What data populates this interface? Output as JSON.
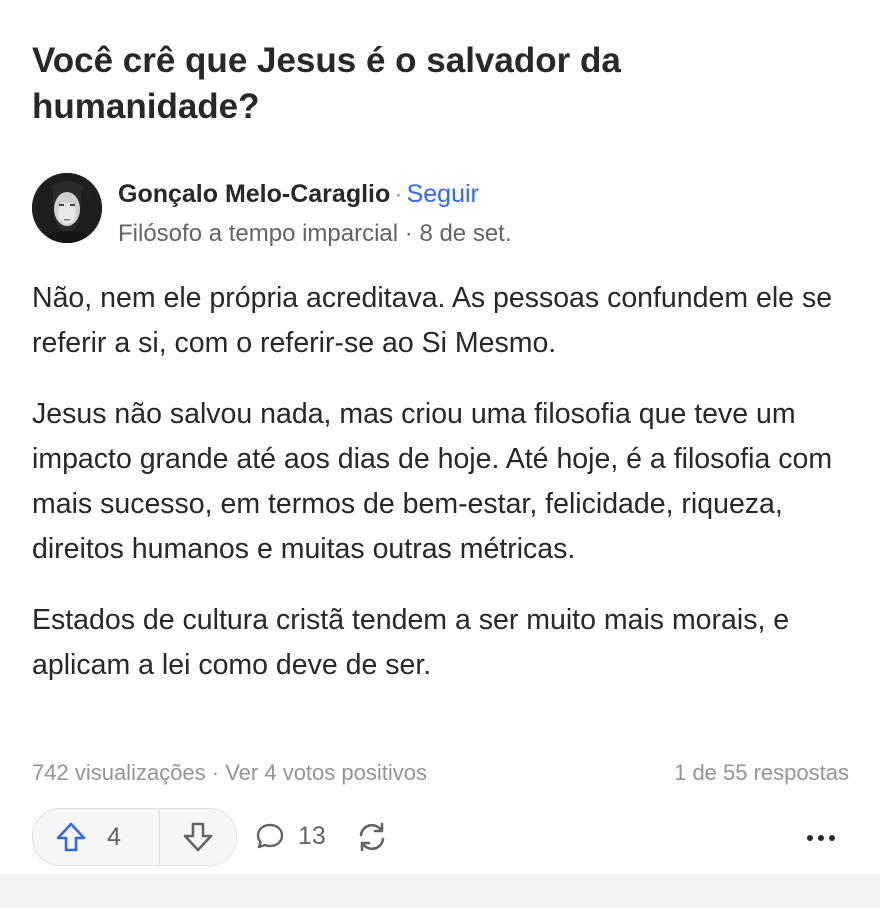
{
  "question": {
    "title": "Você crê que Jesus é o salvador da humanidade?"
  },
  "author": {
    "name": "Gonçalo Melo-Caraglio",
    "separator": "·",
    "follow_label": "Seguir",
    "credential": "Filósofo a tempo imparcial · 8 de set."
  },
  "answer": {
    "paragraphs": [
      "Não, nem ele própria acreditava. As pessoas confundem ele se referir a si, com o referir-se ao Si Mesmo.",
      "Jesus não salvou nada, mas criou uma filosofia que teve um impacto grande até aos dias de hoje. Até hoje, é a filosofia com mais sucesso, em termos de bem-estar, felicidade, riqueza, direitos humanos e muitas outras métricas.",
      "Estados de cultura cristã tendem a ser muito mais morais, e aplicam a lei como deve de ser."
    ]
  },
  "stats": {
    "views_and_votes": "742 visualizações · Ver 4 votos positivos",
    "answer_position": "1 de 55 respostas"
  },
  "actions": {
    "upvote_count": "4",
    "comment_count": "13",
    "icons": {
      "upvote": "upvote-arrow-icon",
      "downvote": "downvote-arrow-icon",
      "comment": "comment-bubble-icon",
      "share": "share-cycle-icon",
      "more": "more-dots-icon"
    }
  },
  "colors": {
    "text": "#282829",
    "muted": "#636466",
    "light_muted": "#939598",
    "accent_blue": "#2e69ff",
    "pill_border": "#dee0e1"
  }
}
